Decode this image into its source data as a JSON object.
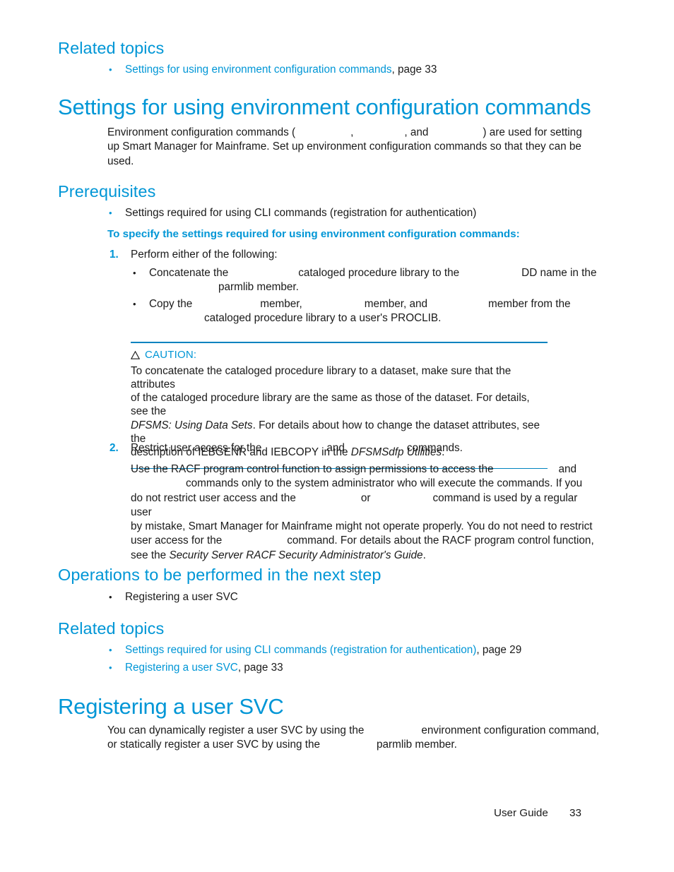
{
  "document": {
    "footer": {
      "label": "User Guide",
      "page_number": "33"
    }
  },
  "related_topics_top": {
    "heading": "Related topics",
    "items": [
      {
        "link": "Settings for using environment configuration commands",
        "suffix": ", page 33"
      }
    ]
  },
  "section_settings": {
    "heading": "Settings for using environment configuration commands",
    "intro_line1_a": "Environment configuration commands (",
    "intro_line1_b": ",",
    "intro_line1_c": ", and",
    "intro_line1_d": ") are used for setting",
    "intro_line2": "up Smart Manager for Mainframe. Set up environment configuration commands so that they can be",
    "intro_line3": "used."
  },
  "prerequisites": {
    "heading": "Prerequisites",
    "items": [
      "Settings required for using CLI commands (registration for authentication)"
    ]
  },
  "procedure": {
    "lead_in": "To specify the settings required for using environment configuration commands:",
    "steps": [
      {
        "number": "1.",
        "text": "Perform either of the following:",
        "substeps": [
          {
            "a": "Concatenate the",
            "b": "cataloged procedure library to the",
            "c": "DD name in the",
            "d": "parmlib member."
          },
          {
            "a": "Copy the",
            "b": "member,",
            "c": "member, and",
            "d": "member from the",
            "e": "cataloged procedure library to a user's PROCLIB."
          }
        ]
      },
      {
        "number": "2.",
        "title_a": "Restrict user access for the",
        "title_b": "and",
        "title_c": "commands.",
        "body_l1_a": "Use the RACF program control function to assign permissions to access the",
        "body_l1_b": "and",
        "body_l2_a": "commands only to the system administrator who will execute the commands. If you",
        "body_l3_a": "do not restrict user access and the",
        "body_l3_b": "or",
        "body_l3_c": "command is used by a regular user",
        "body_l4": "by mistake, Smart Manager for Mainframe might not operate properly. You do not need to restrict",
        "body_l5_a": "user access for the",
        "body_l5_b": "command. For details about the RACF program control function,",
        "body_l6_a": "see the",
        "body_l6_italic": "Security Server RACF Security Administrator's Guide",
        "body_l6_b": "."
      }
    ]
  },
  "caution": {
    "icon": "warning-triangle-icon",
    "title": "CAUTION:",
    "line1": "To concatenate the cataloged procedure library to a dataset, make sure that the attributes",
    "line2": "of the cataloged procedure library are the same as those of the dataset. For details, see the",
    "line3_italic": "DFSMS: Using Data Sets",
    "line3_rest": ". For details about how to change the dataset attributes, see the",
    "line4_a": "description of IEBGENR and IEBCOPY in the",
    "line4_italic": "DFSMSdfp Utilities",
    "line4_b": "."
  },
  "next_step": {
    "heading": "Operations to be performed in the next step",
    "items": [
      "Registering a user SVC"
    ]
  },
  "related_topics_bottom": {
    "heading": "Related topics",
    "items": [
      {
        "link": "Settings required for using CLI commands (registration for authentication)",
        "suffix": ", page 29"
      },
      {
        "link": "Registering a user SVC",
        "suffix": ", page 33"
      }
    ]
  },
  "section_svc": {
    "heading": "Registering a user SVC",
    "body_l1_a": "You can dynamically register a user SVC by using the",
    "body_l1_b": "environment configuration command,",
    "body_l2_a": "or statically register a user SVC by using the",
    "body_l2_b": "parmlib member."
  },
  "colors": {
    "accent_blue": "#0096d6",
    "rule_blue": "#0083bf",
    "text": "#1a1a1a"
  }
}
